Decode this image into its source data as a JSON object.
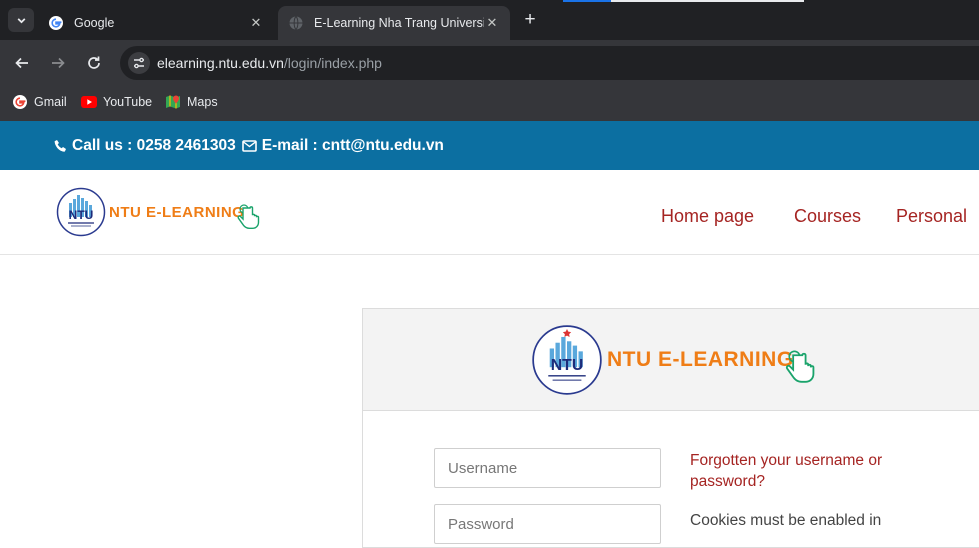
{
  "browser": {
    "tabs": [
      {
        "title": "Google",
        "active": false
      },
      {
        "title": "E-Learning Nha Trang University",
        "active": true
      }
    ],
    "url_host": "elearning.ntu.edu.vn",
    "url_path": "/login/index.php",
    "bookmarks": [
      {
        "label": "Gmail",
        "icon": "google-icon"
      },
      {
        "label": "YouTube",
        "icon": "youtube-icon"
      },
      {
        "label": "Maps",
        "icon": "maps-icon"
      }
    ]
  },
  "contact": {
    "phone_label": "Call us : 0258 2461303",
    "email_label": "E-mail : cntt@ntu.edu.vn"
  },
  "brand": {
    "logo_text": "NTU",
    "name": "NTU E-LEARNING",
    "accent": "#ef7d16",
    "primary": "#0c6fa1",
    "link": "#a52422"
  },
  "nav": {
    "items": [
      "Home page",
      "Courses",
      "Personal"
    ]
  },
  "login": {
    "username_placeholder": "Username",
    "password_placeholder": "Password",
    "forgot_link": "Forgotten your username or password?",
    "cookies_note": "Cookies must be enabled in"
  }
}
